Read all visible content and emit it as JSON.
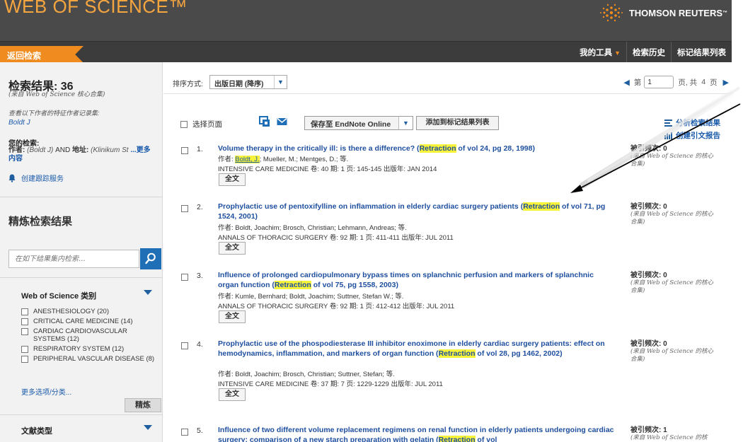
{
  "header": {
    "logo_text": "WEB OF SCIENCE™",
    "brand": "THOMSON REUTERS",
    "brand_tm": "™",
    "accent_color": "#f08c1f"
  },
  "nav": {
    "back_label": "返回检索",
    "my_tools": "我的工具",
    "search_history": "检索历史",
    "marked_list": "标记结果列表"
  },
  "sidebar": {
    "results_title": "检索结果: 36",
    "results_source": "(来自 Web of Science 核心合集)",
    "author_prompt": "查看以下作者的特征作者记录集:",
    "author_link": "Boldt J",
    "your_search_label": "您的检索:",
    "query_author_label": "作者:",
    "query_author_value": "(Boldt J)",
    "query_and": "AND",
    "query_address_label": "地址:",
    "query_address_value": "(Klinikum St",
    "query_more": "...更多内容",
    "create_alert": "创建跟踪服务",
    "refine_title": "精炼检索结果",
    "search_within_placeholder": "在如下结果集内检索...",
    "category_title": "Web of Science 类别",
    "categories": [
      "ANESTHESIOLOGY (20)",
      "CRITICAL CARE MEDICINE (14)",
      "CARDIAC CARDIOVASCULAR SYSTEMS (12)",
      "RESPIRATORY SYSTEM (12)",
      "PERIPHERAL VASCULAR DISEASE (8)"
    ],
    "more_options": "更多选项/分类...",
    "refine_button": "精炼",
    "doctype_title": "文献类型"
  },
  "sortbar": {
    "label": "排序方式:",
    "selected": "出版日期 (降序)",
    "page_prefix": "第",
    "page_value": "1",
    "page_suffix": "页, 共",
    "page_total": "4",
    "page_unit": "页"
  },
  "toolbar": {
    "select_page": "选择页面",
    "endnote": "保存至 EndNote Online",
    "add_marked": "添加到标记结果列表",
    "analyze": "分析检索结果",
    "citation_report": "创建引文报告"
  },
  "results": [
    {
      "num": "1.",
      "title_pre": "Volume therapy in the critically ill: is there a difference? (",
      "title_hl": "Retraction",
      "title_post": " of vol 24, pg 28, 1998)",
      "authors_prefix": "作者: ",
      "authors_hl": "Boldt, J.",
      "authors_rest": "; Mueller, M.; Mentges, D.; 等.",
      "source": "INTENSIVE CARE MEDICINE 卷: 40 期: 1 页: 145-145 出版年: JAN 2014",
      "fulltext": "全文",
      "cited": "被引频次: 0",
      "cited_src": "(来自 Web of Science 的核心合集)"
    },
    {
      "num": "2.",
      "title_pre": "Prophylactic use of pentoxifylline on inflammation in elderly cardiac surgery patients (",
      "title_hl": "Retraction",
      "title_post": " of vol 71, pg 1524, 2001)",
      "authors": "作者: Boldt, Joachim; Brosch, Christian; Lehmann, Andreas; 等.",
      "source": "ANNALS OF THORACIC SURGERY 卷: 92 期: 1 页: 411-411 出版年: JUL 2011",
      "fulltext": "全文",
      "cited": "被引频次: 0",
      "cited_src": "(来自 Web of Science 的核心合集)"
    },
    {
      "num": "3.",
      "title_pre": "Influence of prolonged cardiopulmonary bypass times on splanchnic perfusion and markers of splanchnic organ function (",
      "title_hl": "Retraction",
      "title_post": " of vol 75, pg 1558, 2003)",
      "authors": "作者: Kumle, Bernhard; Boldt, Joachim; Suttner, Stefan W.; 等.",
      "source": "ANNALS OF THORACIC SURGERY 卷: 92 期: 1 页: 412-412 出版年: JUL 2011",
      "fulltext": "全文",
      "cited": "被引频次: 0",
      "cited_src": "(来自 Web of Science 的核心合集)"
    },
    {
      "num": "4.",
      "title_pre": "Prophylactic use of the phospodiesterase III inhibitor enoximone in elderly cardiac surgery patients: effect on hemodynamics, inflammation, and markers of organ function (",
      "title_hl": "Retraction",
      "title_post": " of vol 28, pg 1462, 2002)",
      "authors": "作者: Boldt, Joachim; Brosch, Christian; Suttner, Stefan; 等.",
      "source": "INTENSIVE CARE MEDICINE 卷: 37 期: 7 页: 1229-1229 出版年: JUL 2011",
      "fulltext": "全文",
      "cited": "被引频次: 0",
      "cited_src": "(来自 Web of Science 的核心合集)"
    },
    {
      "num": "5.",
      "title_pre": "Influence of two different volume replacement regimens on renal function in elderly patients undergoing cardiac surgery: comparison of a new starch preparation with gelatin (",
      "title_hl": "Retraction",
      "title_post": " of vol",
      "cited": "被引频次: 1",
      "cited_src": "(来自 Web of Science 的核"
    }
  ]
}
